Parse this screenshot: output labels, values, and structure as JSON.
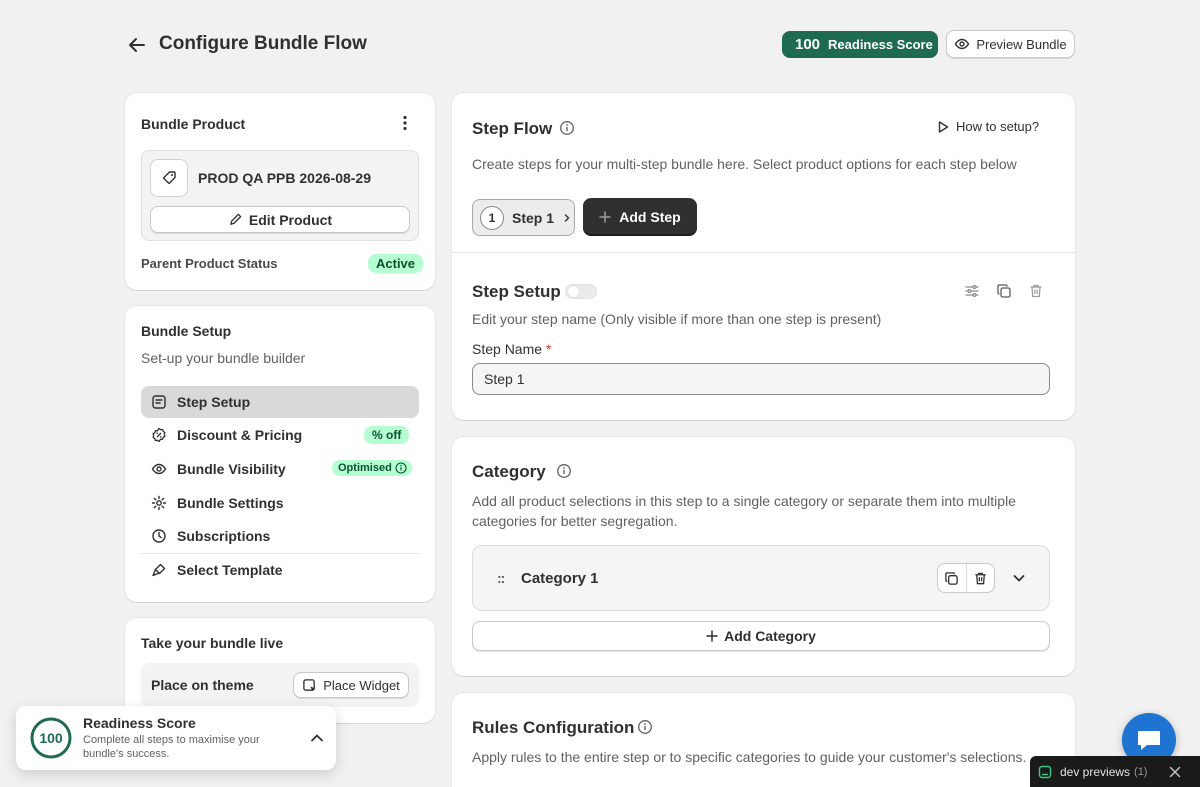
{
  "header": {
    "title": "Configure Bundle Flow",
    "score_value": "100",
    "score_label": "Readiness Score",
    "preview_label": "Preview Bundle"
  },
  "bundle_product": {
    "title": "Bundle Product",
    "product_name": "PROD QA PPB 2026-08-29",
    "edit_label": "Edit Product",
    "status_label": "Parent Product Status",
    "status_value": "Active"
  },
  "bundle_setup": {
    "title": "Bundle Setup",
    "subtitle": "Set-up your bundle builder",
    "items": [
      {
        "label": "Step Setup",
        "badge": ""
      },
      {
        "label": "Discount & Pricing",
        "badge": "% off"
      },
      {
        "label": "Bundle Visibility",
        "badge": "Optimised"
      },
      {
        "label": "Bundle Settings",
        "badge": ""
      },
      {
        "label": "Subscriptions",
        "badge": ""
      },
      {
        "label": "Select Template",
        "badge": ""
      }
    ]
  },
  "go_live": {
    "title": "Take your bundle live",
    "place_label": "Place on theme",
    "widget_label": "Place Widget"
  },
  "readiness_toast": {
    "value": "100",
    "title": "Readiness Score",
    "description": "Complete all steps to maximise your bundle's success."
  },
  "step_flow": {
    "title": "Step Flow",
    "how_to": "How to setup?",
    "description": "Create steps for your multi-step bundle here. Select product options for each step below",
    "step_number": "1",
    "step_label": "Step 1",
    "add_step": "Add Step"
  },
  "step_setup": {
    "title": "Step Setup",
    "description": "Edit your step name (Only visible if more than one step is present)",
    "field_label": "Step Name",
    "required_mark": "*",
    "field_value": "Step 1"
  },
  "category": {
    "title": "Category",
    "description": "Add all product selections in this step to a single category or separate them into multiple categories for better segregation.",
    "item_label": "Category 1",
    "add_label": "Add Category"
  },
  "rules": {
    "title": "Rules Configuration",
    "description": "Apply rules to the entire step or to specific categories to guide your customer's selections."
  },
  "dev_bar": {
    "label": "dev previews",
    "count": "(1)"
  },
  "colors": {
    "brand_green": "#1f6b52",
    "badge_green_bg": "#b4fed2",
    "chat_blue": "#1f74d1",
    "dark_button": "#303030"
  }
}
